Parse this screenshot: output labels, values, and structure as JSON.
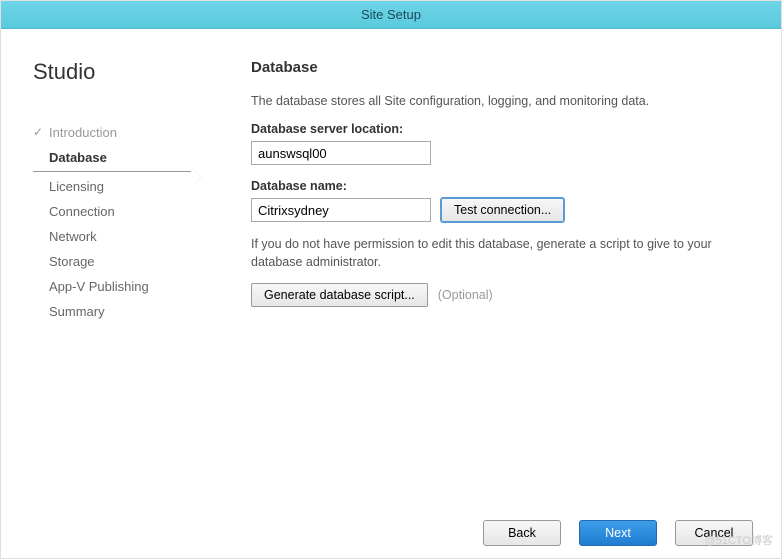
{
  "window": {
    "title": "Site Setup"
  },
  "sidebar": {
    "brand": "Studio",
    "items": [
      {
        "label": "Introduction",
        "state": "completed"
      },
      {
        "label": "Database",
        "state": "active"
      },
      {
        "label": "Licensing",
        "state": ""
      },
      {
        "label": "Connection",
        "state": ""
      },
      {
        "label": "Network",
        "state": ""
      },
      {
        "label": "Storage",
        "state": ""
      },
      {
        "label": "App-V Publishing",
        "state": ""
      },
      {
        "label": "Summary",
        "state": ""
      }
    ]
  },
  "main": {
    "heading": "Database",
    "description": "The database stores all Site configuration, logging, and monitoring data.",
    "server_location_label": "Database server location:",
    "server_location_value": "aunswsql00",
    "db_name_label": "Database name:",
    "db_name_value": "Citrixsydney",
    "test_connection_label": "Test connection...",
    "permission_note": "If you do not have permission to edit this database, generate a script to give to your database administrator.",
    "generate_script_label": "Generate database script...",
    "optional_text": "(Optional)"
  },
  "footer": {
    "back": "Back",
    "next": "Next",
    "cancel": "Cancel"
  },
  "watermark": "@51CTO博客"
}
